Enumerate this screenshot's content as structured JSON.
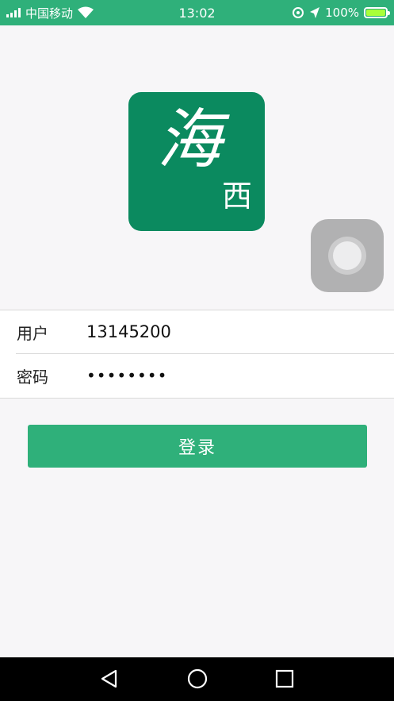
{
  "status_bar": {
    "carrier": "中国移动",
    "time": "13:02",
    "battery_text": "100%",
    "icons": [
      "signal-icon",
      "wifi-icon",
      "location-icon",
      "battery-icon"
    ]
  },
  "logo": {
    "main_char": "海",
    "sub_char": "西"
  },
  "form": {
    "username_label": "用户",
    "username_value": "13145200",
    "password_label": "密码",
    "password_value": "••••••••"
  },
  "login_button": {
    "label": "登录"
  },
  "colors": {
    "accent": "#2fb07a",
    "logo_bg": "#0b8a5f",
    "background": "#f7f6f8"
  },
  "nav_bar": {
    "icons": [
      "back-triangle-icon",
      "home-circle-icon",
      "recent-square-icon"
    ]
  }
}
